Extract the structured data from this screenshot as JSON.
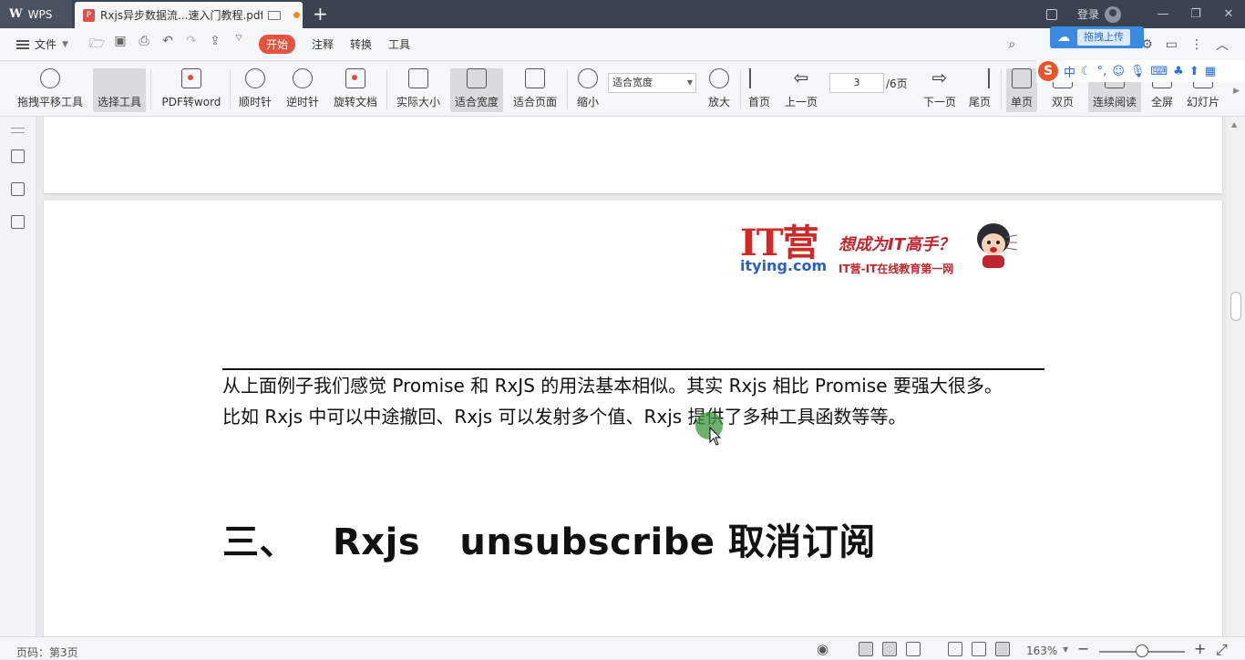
{
  "titlebar": {
    "app_name": "WPS",
    "doc_tab_title": "Rxjs异步数据流...速入门教程.pdf",
    "login_label": "登录"
  },
  "menu": {
    "file": "文件",
    "tabs": [
      "开始",
      "注释",
      "转换",
      "工具"
    ]
  },
  "upload_popup": {
    "label": "拖拽上传"
  },
  "toolbar": {
    "tools": [
      {
        "label": "拖拽平移工具",
        "icon": "hand-icon"
      },
      {
        "label": "选择工具",
        "icon": "cursor-select-icon"
      },
      {
        "label": "PDF转word",
        "icon": "pdf-to-word-icon"
      },
      {
        "label": "顺时针",
        "icon": "rotate-clockwise-icon"
      },
      {
        "label": "逆时针",
        "icon": "rotate-counterclockwise-icon"
      },
      {
        "label": "旋转文档",
        "icon": "rotate-document-icon"
      },
      {
        "label": "实际大小",
        "icon": "actual-size-icon"
      },
      {
        "label": "适合宽度",
        "icon": "fit-width-icon"
      },
      {
        "label": "适合页面",
        "icon": "fit-page-icon"
      },
      {
        "label": "缩小",
        "icon": "zoom-out-icon"
      },
      {
        "label": "放大",
        "icon": "zoom-in-icon"
      },
      {
        "label": "首页",
        "icon": "first-page-icon"
      },
      {
        "label": "上一页",
        "icon": "prev-page-icon"
      },
      {
        "label": "下一页",
        "icon": "next-page-icon"
      },
      {
        "label": "尾页",
        "icon": "last-page-icon"
      },
      {
        "label": "单页",
        "icon": "single-page-icon"
      },
      {
        "label": "双页",
        "icon": "double-page-icon"
      },
      {
        "label": "连续阅读",
        "icon": "continuous-read-icon"
      },
      {
        "label": "全屏",
        "icon": "fullscreen-icon"
      },
      {
        "label": "幻灯片",
        "icon": "slideshow-icon"
      }
    ],
    "zoom_select_value": "适合宽度",
    "page_input_value": "3",
    "page_total": "/6页"
  },
  "ime": {
    "mode": "中"
  },
  "document": {
    "logo": {
      "brand": "IT营",
      "domain": "itying.com",
      "slogan": "想成为IT高手？",
      "subtitle": "IT营-IT在线教育第一网"
    },
    "paragraph_line1": "从上面例子我们感觉 Promise  和  RxJS  的用法基本相似。其实 Rxjs 相比 Promise  要强大很多。",
    "paragraph_line2": "比如 Rxjs 中可以中途撤回、Rxjs 可以发射多个值、Rxjs 提供了多种工具函数等等。",
    "heading_prefix": "三、",
    "heading_text": "Rxjs   unsubscribe 取消订阅"
  },
  "statusbar": {
    "page_info": "页码：第3页",
    "zoom_percent": "163%"
  },
  "colors": {
    "titlebar_bg": "#3b4350",
    "accent_red": "#e35340",
    "upload_blue": "#3c8ae0",
    "logo_red": "#d02a28",
    "logo_blue": "#2b5fc1"
  }
}
